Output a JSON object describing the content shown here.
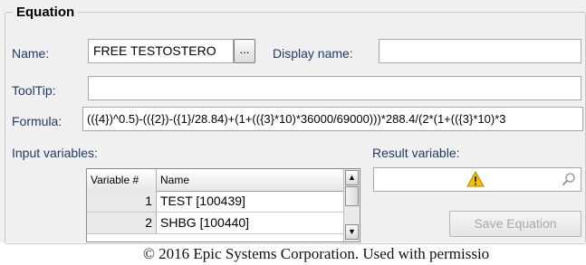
{
  "group": {
    "title": "Equation"
  },
  "name_field": {
    "label": "Name:",
    "value": "FREE TESTOSTERO",
    "browse_label": "..."
  },
  "display_name": {
    "label": "Display name:",
    "value": ""
  },
  "tooltip": {
    "label": "ToolTip:",
    "value": ""
  },
  "formula": {
    "label": "Formula:",
    "value": "(({4})^0.5)-(({2})-({1}/28.84)+(1+(({3}*10)*36000/69000)))*288.4/(2*(1+(({3}*10)*3"
  },
  "input_variables": {
    "label": "Input variables:",
    "columns": [
      "Variable #",
      "Name"
    ],
    "rows": [
      {
        "num": "1",
        "name": "TEST [100439]"
      },
      {
        "num": "2",
        "name": "SHBG [100440]"
      }
    ]
  },
  "result_variable": {
    "label": "Result variable:",
    "value": "",
    "warning_icon": "warning-icon",
    "search_icon": "search-icon"
  },
  "save_button": {
    "label": "Save Equation"
  },
  "footer": {
    "copyright": "© 2016 Epic Systems Corporation. Used with permissio"
  },
  "colors": {
    "label_text": "#1f3b66",
    "panel_bg": "#f0f0f0",
    "warning": "#f2c200",
    "disabled_text": "#a8a8a8"
  }
}
